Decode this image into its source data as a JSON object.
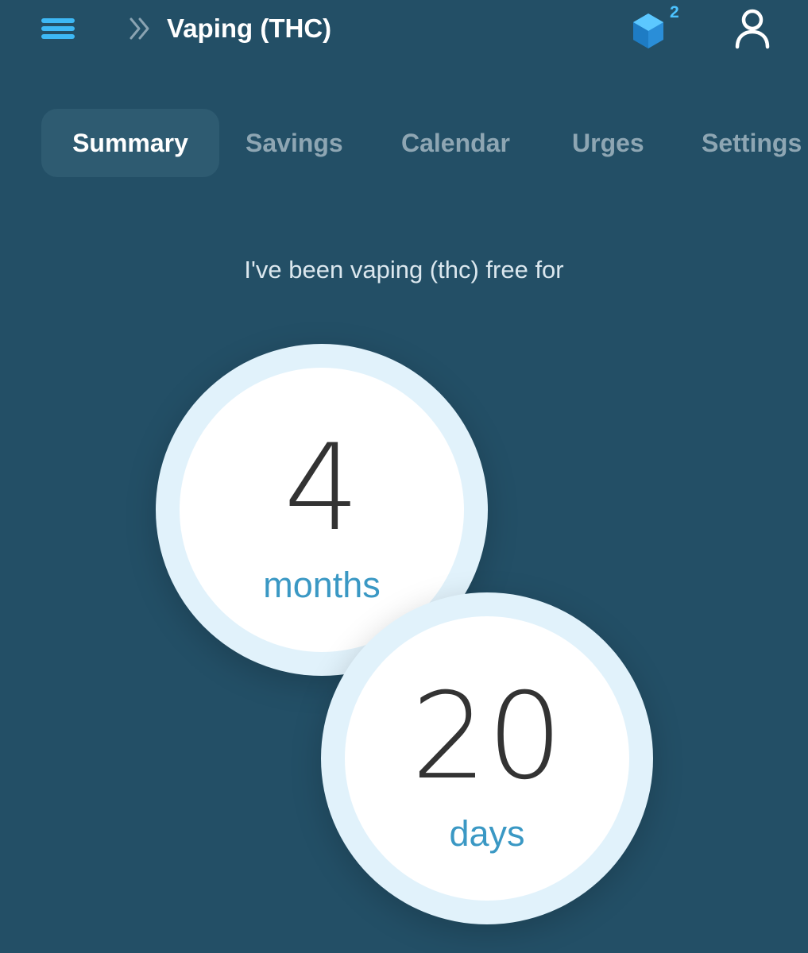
{
  "header": {
    "menu_icon": "hamburger-menu-icon",
    "breadcrumb_icon": "double-chevron-right-icon",
    "title": "Vaping (THC)",
    "badge_icon": "hexagon-gem-icon",
    "badge_count": "2",
    "profile_icon": "user-profile-icon"
  },
  "tabs": [
    {
      "label": "Summary",
      "active": true
    },
    {
      "label": "Savings",
      "active": false
    },
    {
      "label": "Calendar",
      "active": false
    },
    {
      "label": "Urges",
      "active": false
    },
    {
      "label": "Settings",
      "active": false
    }
  ],
  "summary": {
    "intro": "I've been vaping (thc) free for",
    "months_value": "4",
    "months_label": "months",
    "days_value": "20",
    "days_label": "days"
  },
  "colors": {
    "background": "#234f66",
    "active_tab": "#2e5b71",
    "accent": "#4cc3ff",
    "unit_text": "#3a98c4"
  }
}
